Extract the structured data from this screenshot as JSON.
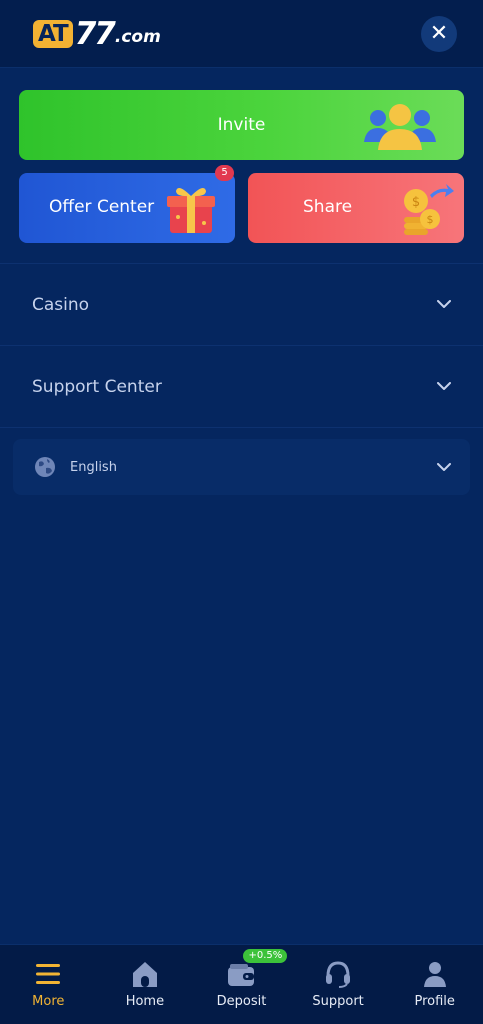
{
  "header": {
    "logo_at": "AT",
    "logo_num": "77",
    "logo_com": ".com",
    "close_icon": "close-icon"
  },
  "cards": {
    "invite": {
      "label": "Invite",
      "icon": "users-icon",
      "color": "#3ccd33"
    },
    "offer": {
      "label": "Offer Center",
      "icon": "gift-icon",
      "badge": "5",
      "color": "#2a61e0"
    },
    "share": {
      "label": "Share",
      "icon": "coins-share-icon",
      "color": "#f4636a"
    }
  },
  "menu": [
    {
      "label": "Casino",
      "icon": "chevron-down-icon"
    },
    {
      "label": "Support Center",
      "icon": "chevron-down-icon"
    }
  ],
  "language": {
    "label": "English",
    "icon": "globe-icon"
  },
  "bottom_nav": [
    {
      "label": "More",
      "icon": "menu-icon",
      "active": true
    },
    {
      "label": "Home",
      "icon": "home-icon",
      "active": false
    },
    {
      "label": "Deposit",
      "icon": "wallet-icon",
      "badge": "+0.5%",
      "active": false
    },
    {
      "label": "Support",
      "icon": "headset-icon",
      "active": false
    },
    {
      "label": "Profile",
      "icon": "profile-icon",
      "active": false
    }
  ],
  "colors": {
    "accent": "#f2b434",
    "background": "#05265f"
  }
}
